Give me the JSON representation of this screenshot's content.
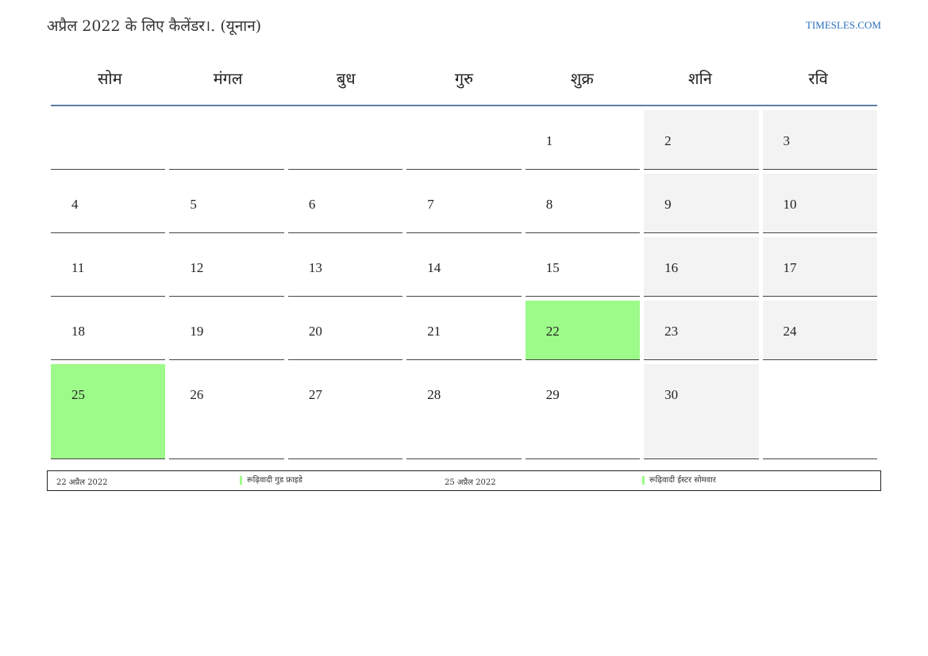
{
  "header": {
    "title": "अप्रैल 2022 के लिए कैलेंडर।. (यूनान)",
    "site": "TIMESLES.COM"
  },
  "weekdays": [
    "सोम",
    "मंगल",
    "बुध",
    "गुरु",
    "शुक्र",
    "शनि",
    "रवि"
  ],
  "weeks": [
    [
      "",
      "",
      "",
      "",
      "1",
      "2",
      "3"
    ],
    [
      "4",
      "5",
      "6",
      "7",
      "8",
      "9",
      "10"
    ],
    [
      "11",
      "12",
      "13",
      "14",
      "15",
      "16",
      "17"
    ],
    [
      "18",
      "19",
      "20",
      "21",
      "22",
      "23",
      "24"
    ],
    [
      "25",
      "26",
      "27",
      "28",
      "29",
      "30",
      ""
    ]
  ],
  "highlighted_days": [
    "22",
    "25"
  ],
  "colors": {
    "holiday": "#9dfb89",
    "weekend": "#f3f3f3",
    "header_rule": "#5a7fa6",
    "link": "#2a6ebb"
  },
  "legend": [
    {
      "date": "22 अप्रैल 2022",
      "name": "रूढ़िवादी गुड फ्राइडे"
    },
    {
      "date": "25 अप्रैल 2022",
      "name": "रूढ़िवादी ईस्टर सोमवार"
    }
  ]
}
